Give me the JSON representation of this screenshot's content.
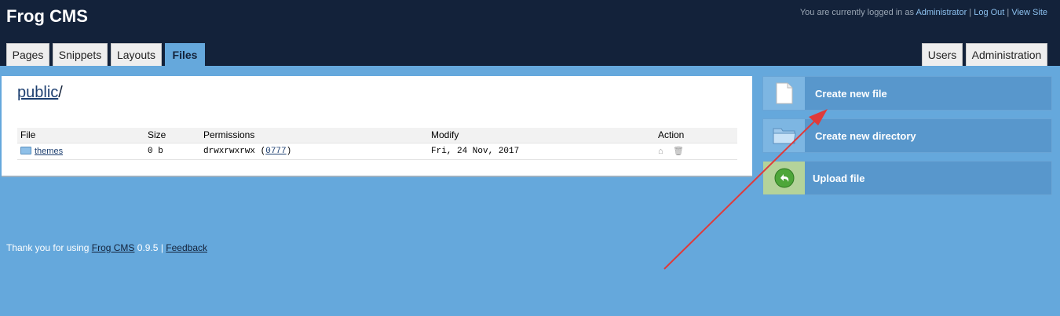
{
  "header": {
    "site_title": "Frog CMS",
    "login_prefix": "You are currently logged in as",
    "user": "Administrator",
    "logout": "Log Out",
    "view_site": "View Site",
    "separator": "|"
  },
  "tabs_left": [
    "Pages",
    "Snippets",
    "Layouts",
    "Files"
  ],
  "tabs_right": [
    "Users",
    "Administration"
  ],
  "active_tab": "Files",
  "path": {
    "link": "public",
    "suffix": "/"
  },
  "table": {
    "headers": [
      "File",
      "Size",
      "Permissions",
      "Modify",
      "Action"
    ],
    "rows": [
      {
        "name": "themes",
        "size": "0 b",
        "permissions": "drwxrwxrwx",
        "mode": "0777",
        "modified": "Fri, 24 Nov, 2017"
      }
    ]
  },
  "sidebar": {
    "create_file": "Create new file",
    "create_directory": "Create new directory",
    "upload_file": "Upload file"
  },
  "footer": {
    "prefix": "Thank you for using",
    "link": "Frog CMS",
    "version": "0.9.5",
    "separator": "|",
    "feedback": "Feedback"
  },
  "colors": {
    "header_bg": "#13223a",
    "page_bg": "#65a8dc",
    "annotation_arrow": "#e03a3a"
  }
}
